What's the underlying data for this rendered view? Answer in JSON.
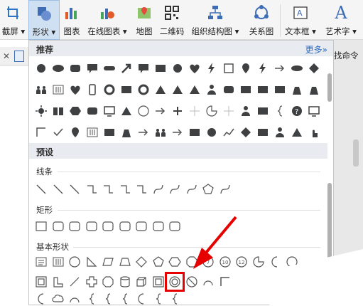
{
  "ribbon": {
    "items": [
      {
        "label": "截屏 ▾",
        "icon": "screenshot-icon"
      },
      {
        "label": "形状 ▾",
        "icon": "shapes-icon"
      },
      {
        "label": "图表",
        "icon": "chart-icon"
      },
      {
        "label": "在线图表 ▾",
        "icon": "online-chart-icon"
      },
      {
        "label": "地图",
        "icon": "map-icon"
      },
      {
        "label": "二维码",
        "icon": "qrcode-icon"
      },
      {
        "label": "组织结构图 ▾",
        "icon": "org-chart-icon"
      },
      {
        "label": "关系图",
        "icon": "relation-icon"
      },
      {
        "label": "文本框 ▾",
        "icon": "textbox-icon"
      },
      {
        "label": "艺术字 ▾",
        "icon": "wordart-icon"
      }
    ],
    "wordart_glyph": "A",
    "find_command": "找命令"
  },
  "panel": {
    "recommended_title": "推荐",
    "more_label": "更多»",
    "presets_title": "预设",
    "categories": {
      "lines": "线条",
      "rectangles": "矩形",
      "basic": "基本形状"
    },
    "basic_labels": {
      "numbered": [
        "7",
        "10",
        "12"
      ]
    }
  },
  "colors": {
    "accent": "#3e6db5",
    "shape_fill": "#3f4042",
    "highlight": "#e60000"
  }
}
